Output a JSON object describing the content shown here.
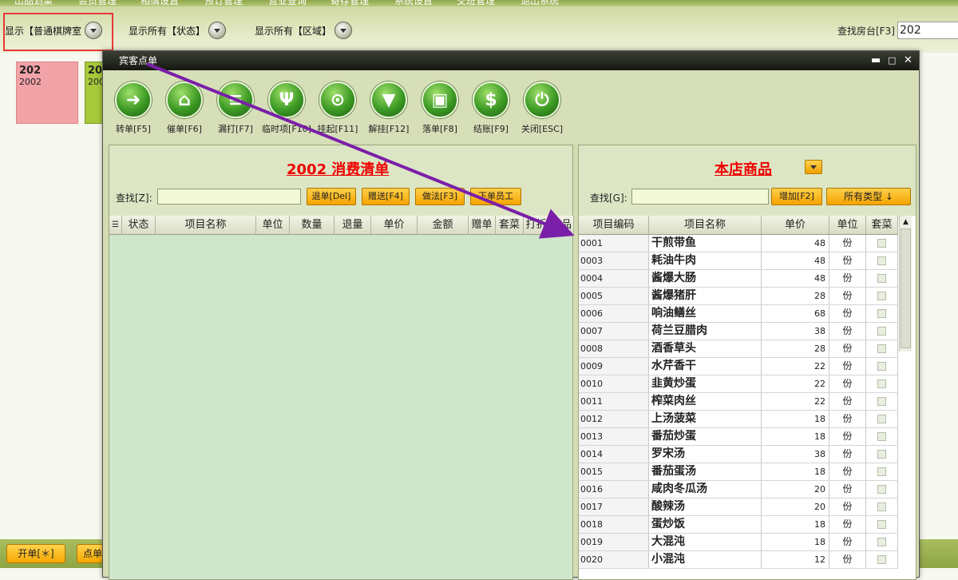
{
  "top_menu": [
    "出品划菜",
    "会员管理",
    "相情设置",
    "预订管理",
    "营业查询",
    "寄存管理",
    "系统设置",
    "交班管理",
    "退出系统"
  ],
  "filters": {
    "show_room_type": "显示【普通棋牌室",
    "show_status": "显示所有【状态】",
    "show_area": "显示所有【区域】",
    "search_room_label": "查找房台[F3]",
    "search_room_value": "202"
  },
  "rooms": [
    {
      "title": "202",
      "sub": "2002",
      "color": "#f2a3a8"
    },
    {
      "title": "20",
      "sub": "200",
      "color": "#a6c83a"
    }
  ],
  "bottom": {
    "open_label": "开单[＊]",
    "order_label": "点单"
  },
  "window": {
    "title": "宾客点单",
    "toolbar": [
      {
        "label": "转单[F5]",
        "icon": "arrow-forward-icon"
      },
      {
        "label": "催单[F6]",
        "icon": "bank-icon"
      },
      {
        "label": "漏打[F7]",
        "icon": "document-icon"
      },
      {
        "label": "临时项[F10]",
        "icon": "fork-spoon-icon"
      },
      {
        "label": "挂起[F11]",
        "icon": "hanger-icon"
      },
      {
        "label": "解挂[F12]",
        "icon": "tie-icon"
      },
      {
        "label": "落单[F8]",
        "icon": "window-icon"
      },
      {
        "label": "结账[F9]",
        "icon": "dollar-icon"
      },
      {
        "label": "关闭[ESC]",
        "icon": "power-icon"
      }
    ]
  },
  "left_panel": {
    "title": "2002 消费清单",
    "search_label": "查找[Z]:",
    "buttons": [
      "退单[Del]",
      "赠送[F4]",
      "做法[F3]",
      "下单员工"
    ],
    "columns": [
      "状态",
      "项目名称",
      "单位",
      "数量",
      "退量",
      "单价",
      "金额",
      "赠单",
      "套菜",
      "打折",
      "商品"
    ]
  },
  "right_panel": {
    "title": "本店商品",
    "search_label": "查找[G]:",
    "add_button": "增加[F2]",
    "type_button": "所有类型 ↓",
    "columns": [
      "项目编码",
      "项目名称",
      "单价",
      "单位",
      "套菜"
    ],
    "items": [
      {
        "code": "0001",
        "name": "干煎带鱼",
        "price": "48",
        "unit": "份"
      },
      {
        "code": "0003",
        "name": "耗油牛肉",
        "price": "48",
        "unit": "份"
      },
      {
        "code": "0004",
        "name": "酱爆大肠",
        "price": "48",
        "unit": "份"
      },
      {
        "code": "0005",
        "name": "酱爆猪肝",
        "price": "28",
        "unit": "份"
      },
      {
        "code": "0006",
        "name": "响油鳝丝",
        "price": "68",
        "unit": "份"
      },
      {
        "code": "0007",
        "name": "荷兰豆腊肉",
        "price": "38",
        "unit": "份"
      },
      {
        "code": "0008",
        "name": "酒香草头",
        "price": "28",
        "unit": "份"
      },
      {
        "code": "0009",
        "name": "水芹香干",
        "price": "22",
        "unit": "份"
      },
      {
        "code": "0010",
        "name": "韭黄炒蛋",
        "price": "22",
        "unit": "份"
      },
      {
        "code": "0011",
        "name": "榨菜肉丝",
        "price": "22",
        "unit": "份"
      },
      {
        "code": "0012",
        "name": "上汤菠菜",
        "price": "18",
        "unit": "份"
      },
      {
        "code": "0013",
        "name": "番茄炒蛋",
        "price": "18",
        "unit": "份"
      },
      {
        "code": "0014",
        "name": "罗宋汤",
        "price": "38",
        "unit": "份"
      },
      {
        "code": "0015",
        "name": "番茄蛋汤",
        "price": "18",
        "unit": "份"
      },
      {
        "code": "0016",
        "name": "咸肉冬瓜汤",
        "price": "20",
        "unit": "份"
      },
      {
        "code": "0017",
        "name": "酸辣汤",
        "price": "20",
        "unit": "份"
      },
      {
        "code": "0018",
        "name": "蛋炒饭",
        "price": "18",
        "unit": "份"
      },
      {
        "code": "0019",
        "name": "大混沌",
        "price": "18",
        "unit": "份"
      },
      {
        "code": "0020",
        "name": "小混沌",
        "price": "12",
        "unit": "份"
      }
    ]
  }
}
